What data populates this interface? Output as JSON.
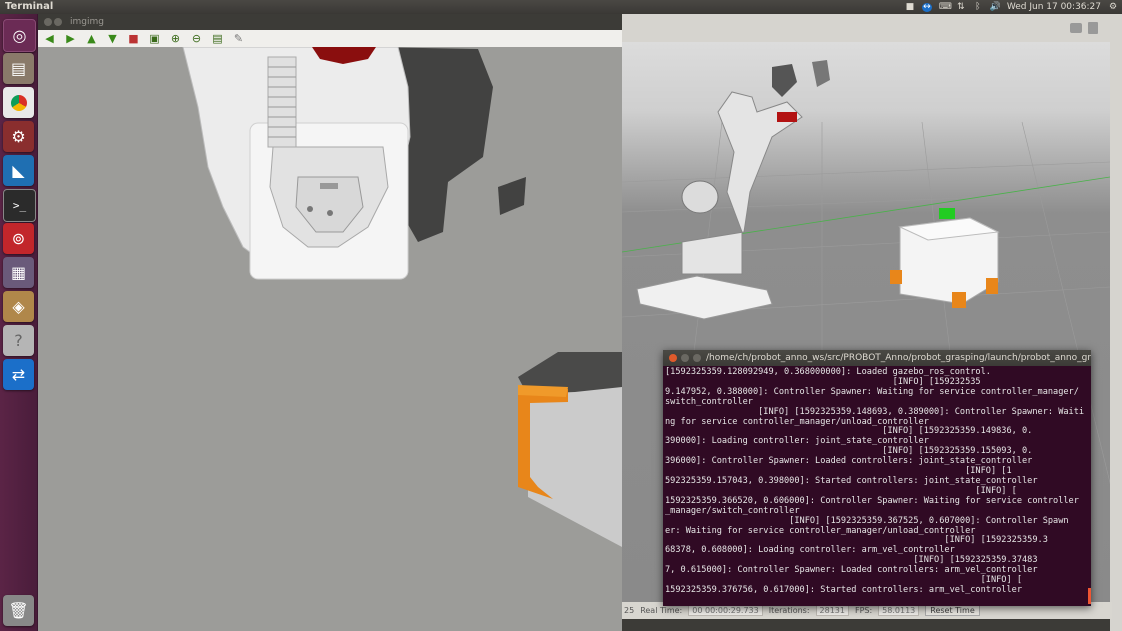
{
  "topbar": {
    "app_title": "Terminal",
    "datetime": "Wed Jun 17 00:36:27"
  },
  "launcher": {
    "items": [
      {
        "name": "ubuntu-dash-icon",
        "color": "#6b2b55"
      },
      {
        "name": "files-icon",
        "color": "#7a6a5a"
      },
      {
        "name": "chrome-icon",
        "color": "#3a7f3a"
      },
      {
        "name": "settings-icon",
        "color": "#8a2e2e"
      },
      {
        "name": "vscode-icon",
        "color": "#1f6fb2"
      },
      {
        "name": "terminal-icon",
        "color": "#2b2b2b"
      },
      {
        "name": "netease-music-icon",
        "color": "#c2262b"
      },
      {
        "name": "media-icon",
        "color": "#6a5a7a"
      },
      {
        "name": "package-icon",
        "color": "#8a5a2a"
      },
      {
        "name": "help-icon",
        "color": "#9a9a9a"
      },
      {
        "name": "teamviewer-icon",
        "color": "#1b6fc9"
      }
    ],
    "trash": {
      "name": "trash-icon"
    }
  },
  "imgimg": {
    "title": "imgimg",
    "tools": [
      "back-arrow-icon",
      "forward-arrow-icon",
      "up-arrow-icon",
      "down-arrow-icon",
      "stop-icon",
      "fit-icon",
      "zoom-in-icon",
      "zoom-out-icon",
      "save-icon",
      "clear-icon"
    ]
  },
  "gazebo": {
    "status": {
      "real_time_label": "Real Time:",
      "real_time_value": "00 00:00:29.733",
      "iterations_label": "Iterations:",
      "iterations_value": "28131",
      "fps_label": "FPS:",
      "fps_value": "58.0113",
      "reset_label": "Reset Time",
      "prefix": "25"
    }
  },
  "terminal": {
    "title": "/home/ch/probot_anno_ws/src/PROBOT_Anno/probot_grasping/launch/probot_anno_gr",
    "lines": [
      "[1592325359.128092949, 0.368000000]: Loaded gazebo_ros_control.",
      "                                            [INFO] [159232535",
      "9.147952, 0.388000]: Controller Spawner: Waiting for service controller_manager/",
      "switch_controller",
      "                  [INFO] [1592325359.148693, 0.389000]: Controller Spawner: Waiti",
      "ng for service controller_manager/unload_controller",
      "                                          [INFO] [1592325359.149836, 0.",
      "390000]: Loading controller: joint_state_controller",
      "                                          [INFO] [1592325359.155093, 0.",
      "396000]: Controller Spawner: Loaded controllers: joint_state_controller",
      "                                                          [INFO] [1",
      "592325359.157043, 0.398000]: Started controllers: joint_state_controller",
      "                                                            [INFO] [",
      "1592325359.366520, 0.606000]: Controller Spawner: Waiting for service controller",
      "_manager/switch_controller",
      "                        [INFO] [1592325359.367525, 0.607000]: Controller Spawn",
      "er: Waiting for service controller_manager/unload_controller",
      "                                                      [INFO] [1592325359.3",
      "68378, 0.608000]: Loading controller: arm_vel_controller",
      "                                                [INFO] [1592325359.37483",
      "7, 0.615000]: Controller Spawner: Loaded controllers: arm_vel_controller",
      "                                                             [INFO] [",
      "1592325359.376756, 0.617000]: Started controllers: arm_vel_controller"
    ]
  }
}
